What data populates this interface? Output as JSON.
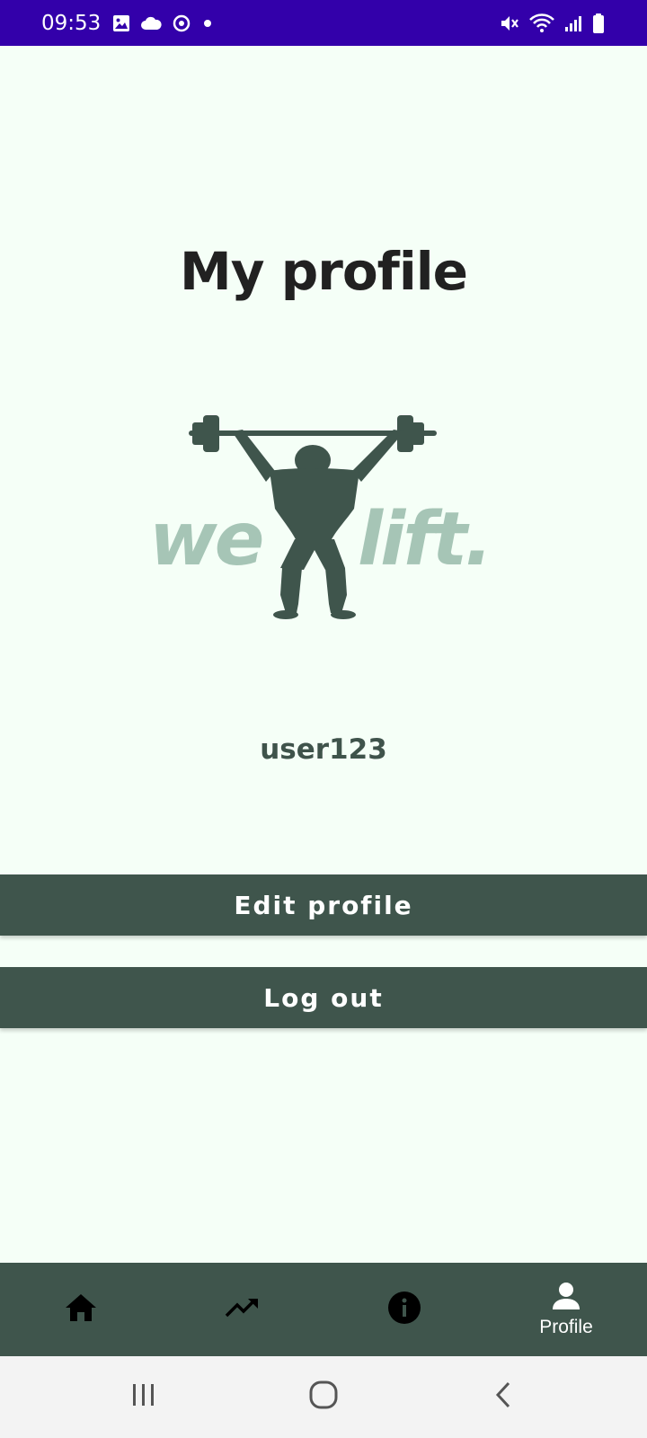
{
  "status_bar": {
    "time": "09:53",
    "background": "#3300aa",
    "left_icons": [
      "gallery-icon",
      "cloud-icon",
      "sync-icon",
      "dot-icon"
    ],
    "right_icons": [
      "mute-icon",
      "wifi-icon",
      "signal-icon",
      "battery-icon"
    ]
  },
  "page": {
    "title": "My profile",
    "username": "user123",
    "background": "#f5fff7"
  },
  "logo": {
    "word_left": "we",
    "word_right": "lift."
  },
  "actions": {
    "edit_label": "Edit profile",
    "logout_label": "Log out",
    "color": "#3f554c"
  },
  "bottom_nav": {
    "items": [
      {
        "icon": "home-icon",
        "label": ""
      },
      {
        "icon": "trending-up-icon",
        "label": ""
      },
      {
        "icon": "info-icon",
        "label": ""
      },
      {
        "icon": "person-icon",
        "label": "Profile",
        "active": true
      }
    ]
  },
  "system_nav": {
    "buttons": [
      "recents-icon",
      "home-circle-icon",
      "back-icon"
    ]
  }
}
